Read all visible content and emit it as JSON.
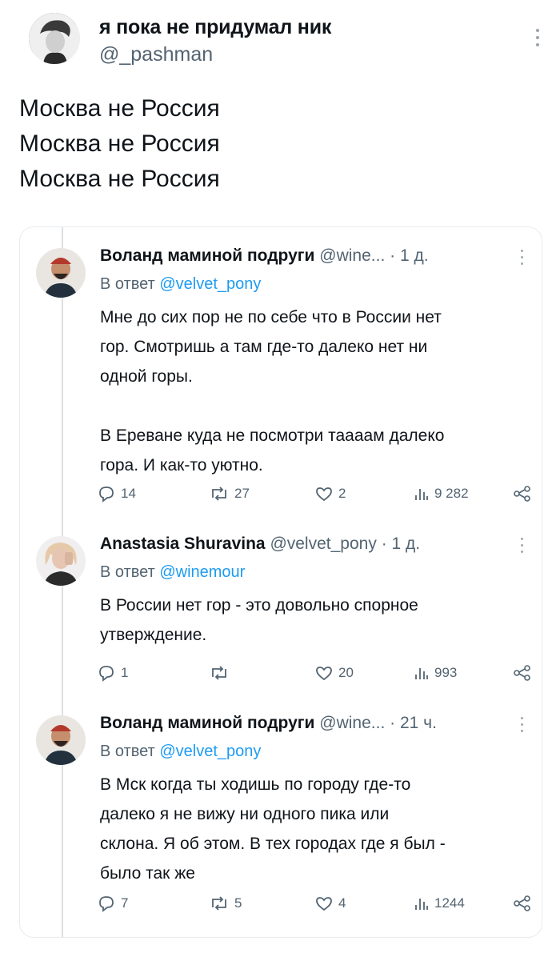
{
  "post": {
    "display_name": "я пока не придумал ник",
    "handle": "@_pashman",
    "lines": [
      "Москва не Россия",
      "Москва не Россия",
      "Москва не Россия"
    ]
  },
  "replies": [
    {
      "name": "Воланд маминой подруги",
      "handle": "@wine...",
      "time": "· 1 д.",
      "replying_prefix": "В ответ",
      "replying_to": "@velvet_pony",
      "text": "Мне до сих пор не по себе что в России нет\nгор. Смотришь а там где-то далеко нет ни\nодной горы.\n\nВ Ереване куда не посмотри тааaам далеко\nгора. И как-то уютно.",
      "stats": {
        "replies": "14",
        "reposts": "27",
        "likes": "2",
        "views": "9 282"
      }
    },
    {
      "name": "Anastasia Shuravina",
      "handle": "@velvet_pony",
      "time": "· 1 д.",
      "replying_prefix": "В ответ",
      "replying_to": "@winemour",
      "text": "В России нет гор - это довольно спорное\nутверждение.",
      "stats": {
        "replies": "1",
        "reposts": "",
        "likes": "20",
        "views": "993"
      }
    },
    {
      "name": "Воланд маминой подруги",
      "handle": "@wine...",
      "time": "· 21 ч.",
      "replying_prefix": "В ответ",
      "replying_to": "@velvet_pony",
      "text": "В Мск когда ты ходишь по городу где-то\nдалеко я не вижу ни одного пика или\nсклона. Я об этом. В тех городах где я был -\nбыло так же",
      "stats": {
        "replies": "7",
        "reposts": "5",
        "likes": "4",
        "views": "1244"
      }
    }
  ],
  "colors": {
    "text": "#0f1419",
    "muted": "#536471",
    "accent": "#1d9bf0",
    "border": "#e8ecef"
  },
  "icons": [
    "more-icon",
    "reply-icon",
    "repost-icon",
    "like-icon",
    "views-icon",
    "share-icon"
  ]
}
